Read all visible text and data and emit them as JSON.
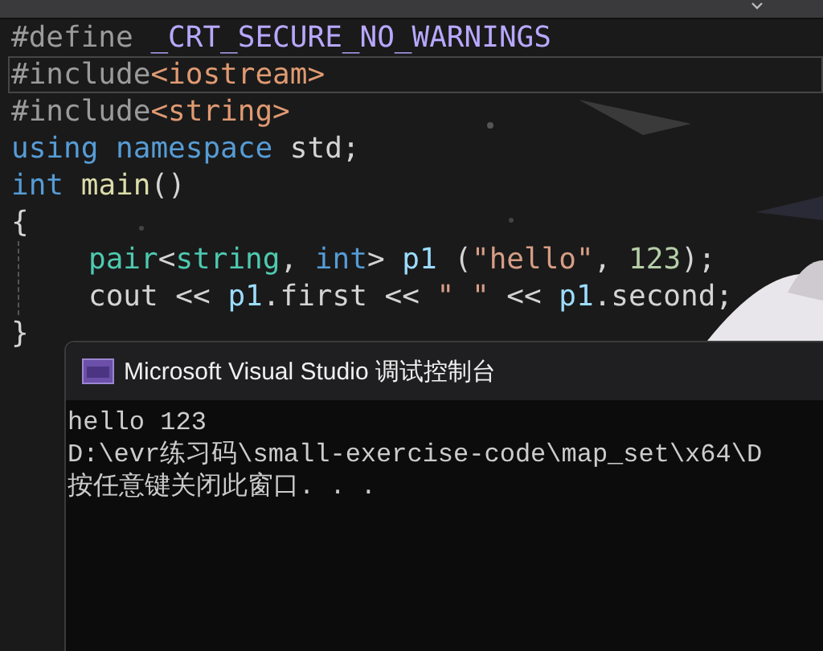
{
  "editor": {
    "lines": [
      {
        "tokens": [
          {
            "text": "#define ",
            "kind": "directive"
          },
          {
            "text": "_CRT_SECURE_NO_WARNINGS",
            "kind": "macro"
          }
        ],
        "current": false
      },
      {
        "tokens": [
          {
            "text": "#include",
            "kind": "directive"
          },
          {
            "text": "<iostream>",
            "kind": "header"
          }
        ],
        "current": true
      },
      {
        "tokens": [
          {
            "text": "#include",
            "kind": "directive"
          },
          {
            "text": "<string>",
            "kind": "header"
          }
        ],
        "current": false
      },
      {
        "tokens": [
          {
            "text": "using namespace ",
            "kind": "keyword"
          },
          {
            "text": "std;",
            "kind": "plain"
          }
        ],
        "current": false
      },
      {
        "tokens": [
          {
            "text": "int ",
            "kind": "keyword"
          },
          {
            "text": "main",
            "kind": "function"
          },
          {
            "text": "()",
            "kind": "plain"
          }
        ],
        "current": false
      },
      {
        "tokens": [
          {
            "text": "{",
            "kind": "plain"
          }
        ],
        "current": false,
        "children": [
          {
            "tokens": [
              {
                "text": "pair",
                "kind": "type"
              },
              {
                "text": "<",
                "kind": "plain"
              },
              {
                "text": "string",
                "kind": "type"
              },
              {
                "text": ", ",
                "kind": "plain"
              },
              {
                "text": "int",
                "kind": "keyword"
              },
              {
                "text": "> ",
                "kind": "plain"
              },
              {
                "text": "p1",
                "kind": "variable"
              },
              {
                "text": " (",
                "kind": "plain"
              },
              {
                "text": "\"hello\"",
                "kind": "string"
              },
              {
                "text": ", ",
                "kind": "plain"
              },
              {
                "text": "123",
                "kind": "number"
              },
              {
                "text": ");",
                "kind": "plain"
              }
            ],
            "current": false
          },
          {
            "tokens": [
              {
                "text": "cout << ",
                "kind": "plain"
              },
              {
                "text": "p1",
                "kind": "variable"
              },
              {
                "text": ".first << ",
                "kind": "plain"
              },
              {
                "text": "\" \"",
                "kind": "string"
              },
              {
                "text": " << ",
                "kind": "plain"
              },
              {
                "text": "p1",
                "kind": "variable"
              },
              {
                "text": ".second;",
                "kind": "plain"
              }
            ],
            "current": false
          }
        ]
      },
      {
        "tokens": [
          {
            "text": "}",
            "kind": "plain"
          }
        ],
        "current": false
      }
    ]
  },
  "console": {
    "title": "Microsoft Visual Studio 调试控制台",
    "output": [
      "hello 123",
      "D:\\evr练习码\\small-exercise-code\\map_set\\x64\\D",
      "按任意键关闭此窗口. . ."
    ]
  }
}
